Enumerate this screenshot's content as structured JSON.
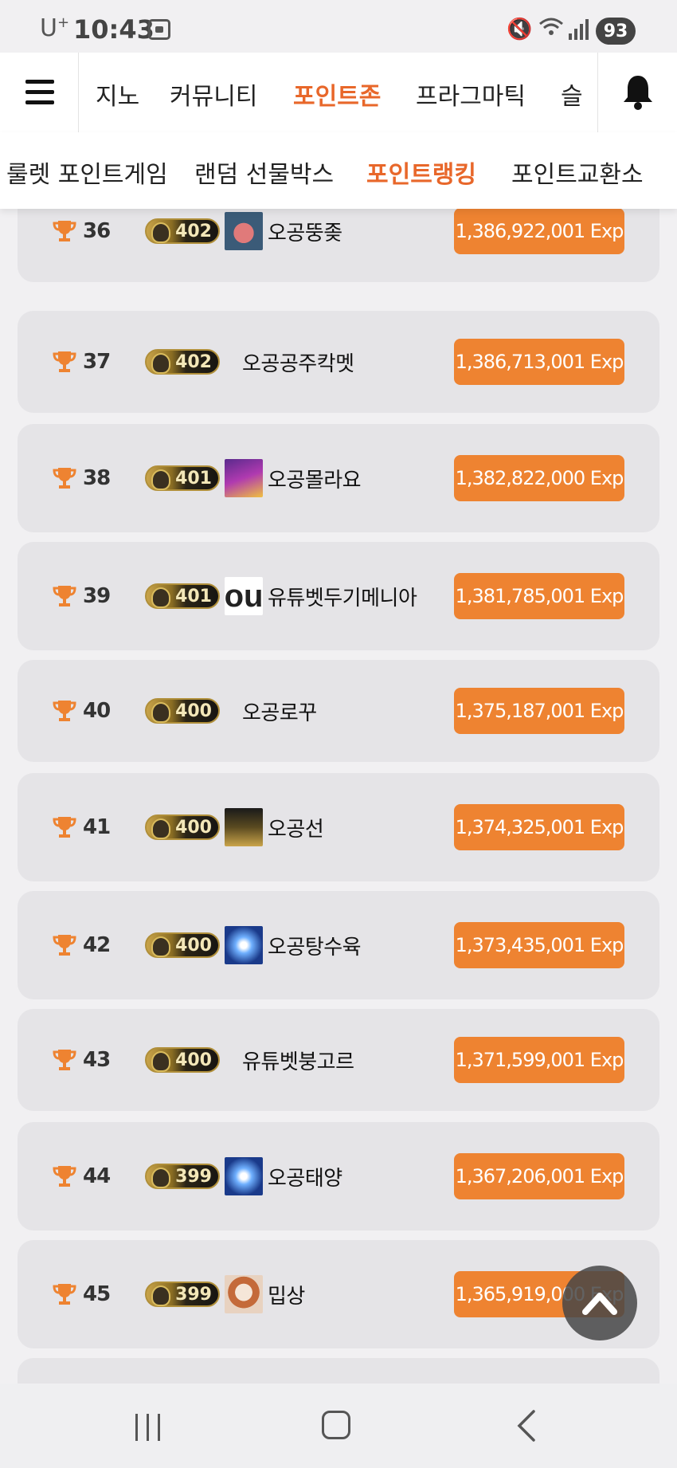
{
  "status_bar": {
    "carrier": "U",
    "carrier_sup": "+",
    "time": "10:43",
    "battery": "93",
    "icons": [
      "screenshot-icon",
      "mute-icon",
      "wifi-icon",
      "signal-icon"
    ]
  },
  "top_nav": {
    "tabs": [
      {
        "label": "지노",
        "active": false
      },
      {
        "label": "커뮤니티",
        "active": false
      },
      {
        "label": "포인트존",
        "active": true
      },
      {
        "label": "프라그마틱",
        "active": false
      },
      {
        "label": "슬",
        "active": false
      }
    ],
    "menu_icon": "hamburger-menu-icon",
    "bell_icon": "bell-icon"
  },
  "sub_nav": {
    "tabs": [
      {
        "label": "룰렛 포인트게임",
        "active": false
      },
      {
        "label": "랜덤 선물박스",
        "active": false
      },
      {
        "label": "포인트랭킹",
        "active": true
      },
      {
        "label": "포인트교환소",
        "active": false
      }
    ]
  },
  "ranking": [
    {
      "rank": "36",
      "level": "402",
      "avatar": "pink-character",
      "nickname": "오공뚱좆",
      "exp": "1,386,922,001 Exp"
    },
    {
      "rank": "37",
      "level": "402",
      "avatar": "",
      "nickname": "오공공주칵멧",
      "exp": "1,386,713,001 Exp"
    },
    {
      "rank": "38",
      "level": "401",
      "avatar": "purple-game",
      "nickname": "오공몰라요",
      "exp": "1,382,822,000 Exp"
    },
    {
      "rank": "39",
      "level": "401",
      "avatar": "you-text",
      "nickname": "유튜벳두기메니아",
      "exp": "1,381,785,001 Exp"
    },
    {
      "rank": "40",
      "level": "400",
      "avatar": "",
      "nickname": "오공로꾸",
      "exp": "1,375,187,001 Exp"
    },
    {
      "rank": "41",
      "level": "400",
      "avatar": "slot-logo",
      "nickname": "오공선",
      "exp": "1,374,325,001 Exp"
    },
    {
      "rank": "42",
      "level": "400",
      "avatar": "blue-lightning",
      "nickname": "오공탕수육",
      "exp": "1,373,435,001 Exp"
    },
    {
      "rank": "43",
      "level": "400",
      "avatar": "",
      "nickname": "유튜벳붕고르",
      "exp": "1,371,599,001 Exp"
    },
    {
      "rank": "44",
      "level": "399",
      "avatar": "blue-lightning",
      "nickname": "오공태양",
      "exp": "1,367,206,001 Exp"
    },
    {
      "rank": "45",
      "level": "399",
      "avatar": "cartoon-face",
      "nickname": "밉상",
      "exp": "1,365,919,000 Exp"
    }
  ],
  "colors": {
    "accent": "#e8672a",
    "exp_button": "#ee8331",
    "row_bg": "#e5e4e7"
  }
}
